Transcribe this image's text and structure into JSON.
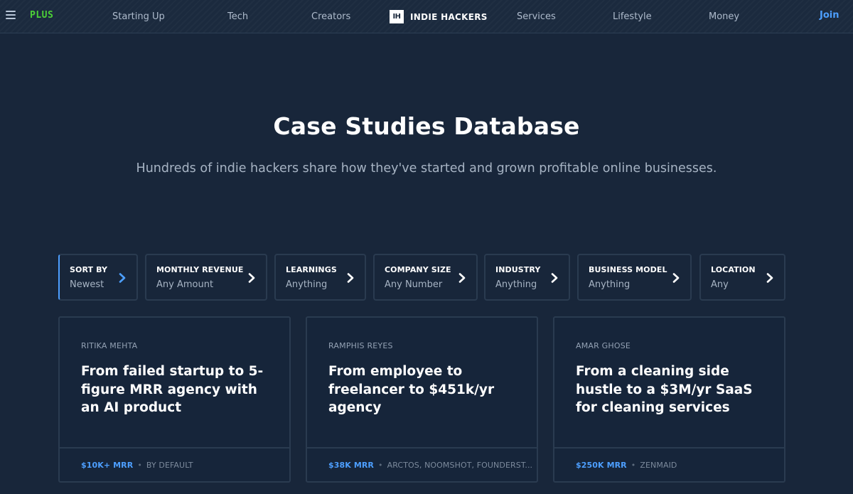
{
  "nav": {
    "plus": "PLUS",
    "links": [
      "Starting Up",
      "Tech",
      "Creators",
      "Services",
      "Lifestyle",
      "Money"
    ],
    "brand_box": "IH",
    "brand_text": "INDIE HACKERS",
    "join": "Join"
  },
  "hero": {
    "title": "Case Studies Database",
    "subtitle": "Hundreds of indie hackers share how they've started and grown profitable online businesses."
  },
  "filters": [
    {
      "label": "SORT BY",
      "value": "Newest"
    },
    {
      "label": "MONTHLY REVENUE",
      "value": "Any Amount"
    },
    {
      "label": "LEARNINGS",
      "value": "Anything"
    },
    {
      "label": "COMPANY SIZE",
      "value": "Any Number"
    },
    {
      "label": "INDUSTRY",
      "value": "Anything"
    },
    {
      "label": "BUSINESS MODEL",
      "value": "Anything"
    },
    {
      "label": "LOCATION",
      "value": "Any"
    }
  ],
  "cards": [
    {
      "author": "RITIKA MEHTA",
      "title": "From failed startup to 5-figure MRR agency with an AI product",
      "mrr": "$10K+ MRR",
      "dot": "•",
      "company": "BY DEFAULT"
    },
    {
      "author": "RAMPHIS REYES",
      "title": "From employee to freelancer to $451k/yr agency",
      "mrr": "$38K MRR",
      "dot": "•",
      "company": "ARCTOS, NOOMSHOT, FOUNDERST..."
    },
    {
      "author": "AMAR GHOSE",
      "title": "From a cleaning side hustle to a $3M/yr SaaS for cleaning services",
      "mrr": "$250K MRR",
      "dot": "•",
      "company": "ZENMAID"
    }
  ],
  "colors": {
    "background": "#18263a",
    "accent": "#4d9fff",
    "plus_green": "#4cd137"
  }
}
